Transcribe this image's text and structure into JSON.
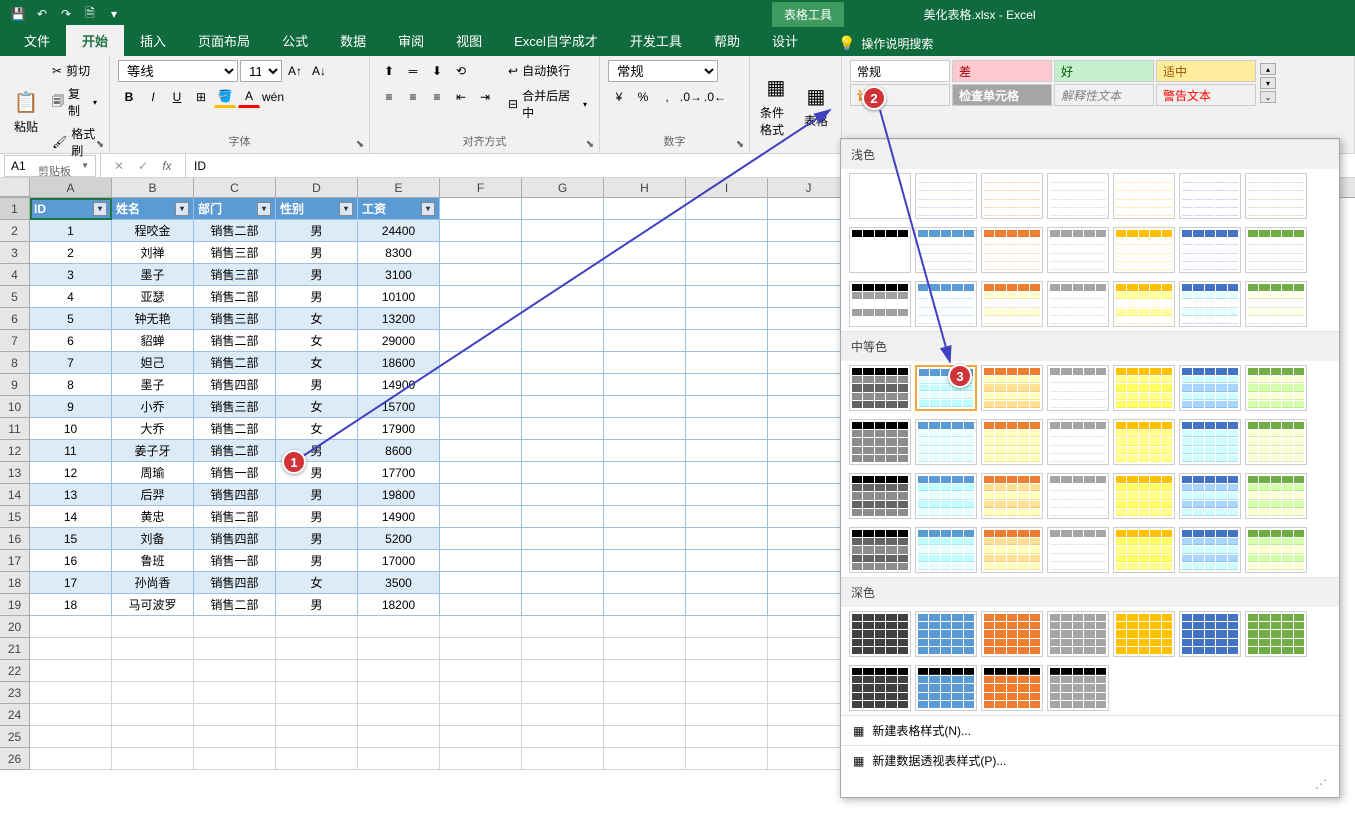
{
  "title": "美化表格.xlsx - Excel",
  "context_tab": "表格工具",
  "qat": {
    "save": "💾",
    "undo": "↶",
    "redo": "↷",
    "preview": "🗎",
    "more": "▾"
  },
  "tabs": [
    "文件",
    "开始",
    "插入",
    "页面布局",
    "公式",
    "数据",
    "审阅",
    "视图",
    "Excel自学成才",
    "开发工具",
    "帮助",
    "设计"
  ],
  "active_tab": "开始",
  "tell_me": "操作说明搜索",
  "groups": {
    "clipboard": {
      "label": "剪贴板",
      "paste": "粘贴",
      "cut": "剪切",
      "copy": "复制",
      "format_painter": "格式刷"
    },
    "font": {
      "label": "字体",
      "name": "等线",
      "size": "11"
    },
    "alignment": {
      "label": "对齐方式",
      "wrap": "自动换行",
      "merge": "合并后居中"
    },
    "number": {
      "label": "数字",
      "format": "常规"
    },
    "cond_format": "条件格式",
    "table_format": "表格"
  },
  "style_cells": {
    "normal": "常规",
    "bad": "差",
    "good": "好",
    "neutral": "适中",
    "calc": "计算",
    "check": "检查单元格",
    "explain": "解释性文本",
    "warn": "警告文本"
  },
  "table_gallery": {
    "light": "浅色",
    "medium": "中等色",
    "dark": "深色",
    "new_style": "新建表格样式(N)...",
    "new_pivot_style": "新建数据透视表样式(P)..."
  },
  "name_box": "A1",
  "formula": "ID",
  "columns": [
    "A",
    "B",
    "C",
    "D",
    "E",
    "F",
    "G",
    "H",
    "I",
    "J"
  ],
  "headers": [
    "ID",
    "姓名",
    "部门",
    "性别",
    "工资"
  ],
  "rows": [
    {
      "id": "1",
      "name": "程咬金",
      "dept": "销售二部",
      "sex": "男",
      "salary": "24400"
    },
    {
      "id": "2",
      "name": "刘禅",
      "dept": "销售三部",
      "sex": "男",
      "salary": "8300"
    },
    {
      "id": "3",
      "name": "墨子",
      "dept": "销售三部",
      "sex": "男",
      "salary": "3100"
    },
    {
      "id": "4",
      "name": "亚瑟",
      "dept": "销售二部",
      "sex": "男",
      "salary": "10100"
    },
    {
      "id": "5",
      "name": "钟无艳",
      "dept": "销售三部",
      "sex": "女",
      "salary": "13200"
    },
    {
      "id": "6",
      "name": "貂蝉",
      "dept": "销售二部",
      "sex": "女",
      "salary": "29000"
    },
    {
      "id": "7",
      "name": "妲己",
      "dept": "销售二部",
      "sex": "女",
      "salary": "18600"
    },
    {
      "id": "8",
      "name": "墨子",
      "dept": "销售四部",
      "sex": "男",
      "salary": "14900"
    },
    {
      "id": "9",
      "name": "小乔",
      "dept": "销售三部",
      "sex": "女",
      "salary": "15700"
    },
    {
      "id": "10",
      "name": "大乔",
      "dept": "销售二部",
      "sex": "女",
      "salary": "17900"
    },
    {
      "id": "11",
      "name": "姜子牙",
      "dept": "销售二部",
      "sex": "男",
      "salary": "8600"
    },
    {
      "id": "12",
      "name": "周瑜",
      "dept": "销售一部",
      "sex": "男",
      "salary": "17700"
    },
    {
      "id": "13",
      "name": "后羿",
      "dept": "销售四部",
      "sex": "男",
      "salary": "19800"
    },
    {
      "id": "14",
      "name": "黄忠",
      "dept": "销售二部",
      "sex": "男",
      "salary": "14900"
    },
    {
      "id": "15",
      "name": "刘备",
      "dept": "销售四部",
      "sex": "男",
      "salary": "5200"
    },
    {
      "id": "16",
      "name": "鲁班",
      "dept": "销售一部",
      "sex": "男",
      "salary": "17000"
    },
    {
      "id": "17",
      "name": "孙尚香",
      "dept": "销售四部",
      "sex": "女",
      "salary": "3500"
    },
    {
      "id": "18",
      "name": "马可波罗",
      "dept": "销售二部",
      "sex": "男",
      "salary": "18200"
    }
  ],
  "callouts": {
    "1": "1",
    "2": "2",
    "3": "3"
  },
  "gallery_colors": {
    "light": [
      "#000",
      "#5b9bd5",
      "#ed7d31",
      "#a5a5a5",
      "#ffc000",
      "#4472c4",
      "#70ad47"
    ],
    "medium": [
      "#000",
      "#5b9bd5",
      "#ed7d31",
      "#a5a5a5",
      "#ffc000",
      "#4472c4",
      "#70ad47"
    ],
    "dark": [
      "#404040",
      "#5b9bd5",
      "#ed7d31",
      "#a5a5a5",
      "#ffc000",
      "#4472c4",
      "#70ad47"
    ]
  }
}
